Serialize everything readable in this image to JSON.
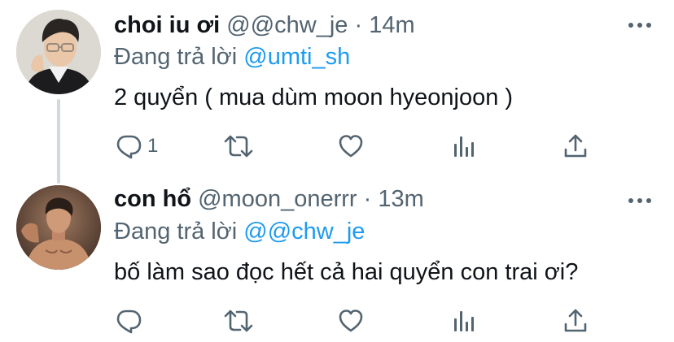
{
  "colors": {
    "link": "#1d9bf0",
    "secondary_text": "#536471",
    "primary_text": "#0f1419",
    "thread_line": "#cfd9de"
  },
  "tweets": [
    {
      "display_name": "choi iu ơi",
      "handle": "@@chw_je",
      "separator": "·",
      "time": "14m",
      "reply_prefix": "Đang trả lời",
      "reply_to": "@umti_sh",
      "text": "2 quyển ( mua dùm moon hyeonjoon )",
      "reply_count": "1",
      "icons": [
        "reply-icon",
        "retweet-icon",
        "like-icon",
        "analytics-icon",
        "share-icon"
      ]
    },
    {
      "display_name": "con hổ",
      "handle": "@moon_onerrr",
      "separator": "·",
      "time": "13m",
      "reply_prefix": "Đang trả lời",
      "reply_to": "@@chw_je",
      "text": "bố làm sao đọc hết cả hai quyển con trai ơi?",
      "reply_count": "",
      "icons": [
        "reply-icon",
        "retweet-icon",
        "like-icon",
        "analytics-icon",
        "share-icon"
      ]
    }
  ]
}
